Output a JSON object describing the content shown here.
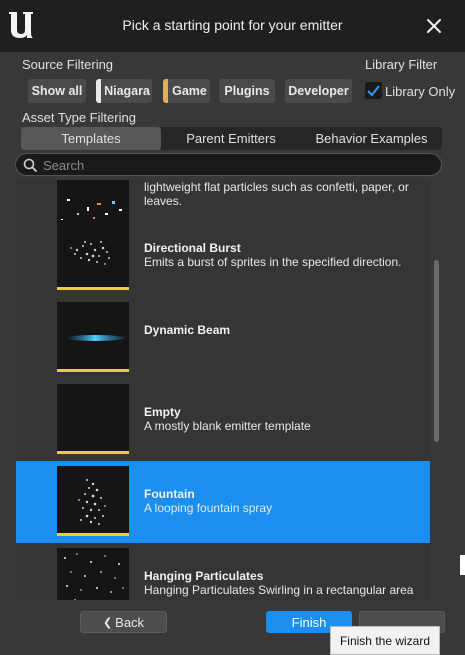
{
  "window": {
    "title": "Pick a starting point for your emitter"
  },
  "source_filtering": {
    "label": "Source Filtering",
    "buttons": [
      {
        "label": "Show all",
        "stripe": null
      },
      {
        "label": "Niagara",
        "stripe": "#e8e8e8"
      },
      {
        "label": "Game",
        "stripe": "#e0b060"
      },
      {
        "label": "Plugins",
        "stripe": null
      },
      {
        "label": "Developer",
        "stripe": null
      }
    ]
  },
  "library_filter": {
    "label": "Library Filter",
    "checkbox_label": "Library Only",
    "checked": true
  },
  "asset_type_filtering": {
    "label": "Asset Type Filtering",
    "tabs": [
      "Templates",
      "Parent Emitters",
      "Behavior Examples"
    ],
    "active_tab": "Templates"
  },
  "search": {
    "placeholder": "Search",
    "value": ""
  },
  "emitters": [
    {
      "title": "",
      "desc": "lightweight flat particles such as confetti, paper, or leaves.",
      "selected": false,
      "thumb": "confetti"
    },
    {
      "title": "Directional Burst",
      "desc": "Emits a burst of sprites in the specified direction.",
      "selected": false,
      "thumb": "burst"
    },
    {
      "title": "Dynamic Beam",
      "desc": "",
      "selected": false,
      "thumb": "beam"
    },
    {
      "title": "Empty",
      "desc": "A mostly blank emitter template",
      "selected": false,
      "thumb": "empty"
    },
    {
      "title": "Fountain",
      "desc": "A looping fountain spray",
      "selected": true,
      "thumb": "fountain"
    },
    {
      "title": "Hanging Particulates",
      "desc": "Hanging Particulates Swirling in a rectangular area",
      "selected": false,
      "thumb": "particulates"
    }
  ],
  "footer": {
    "back_label": "Back",
    "finish_label": "Finish",
    "cancel_label": ""
  },
  "tooltip": {
    "text": "Finish the wizard"
  },
  "colors": {
    "accent": "#1a8ff0",
    "thumb_bar": "#e8d03c",
    "titlebar": "#1f1f1f",
    "panel": "#383838"
  }
}
